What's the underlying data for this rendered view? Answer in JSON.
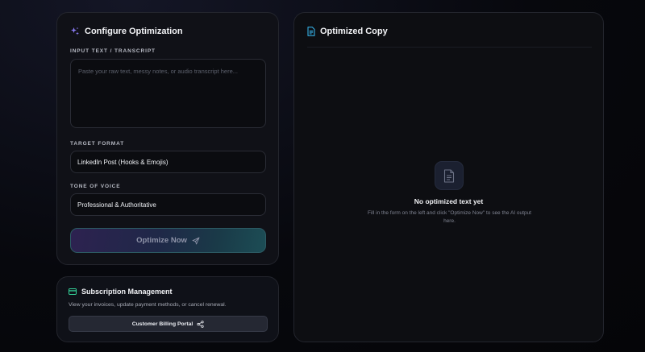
{
  "config": {
    "title": "Configure Optimization",
    "input_label": "INPUT TEXT / TRANSCRIPT",
    "input_placeholder": "Paste your raw text, messy notes, or audio transcript here...",
    "input_value": "",
    "format_label": "TARGET FORMAT",
    "format_value": "LinkedIn Post (Hooks & Emojis)",
    "tone_label": "TONE OF VOICE",
    "tone_value": "Professional & Authoritative",
    "optimize_label": "Optimize Now"
  },
  "billing": {
    "title": "Subscription Management",
    "description": "View your invoices, update payment methods, or cancel renewal.",
    "button_label": "Customer Billing Portal"
  },
  "output": {
    "title": "Optimized Copy",
    "empty_title": "No optimized text yet",
    "empty_description": "Fill in the form on the left and click \"Optimize Now\" to see the AI output here."
  },
  "icons": {
    "sparkles": "sparkles-icon",
    "card": "credit-card-icon",
    "document": "document-icon",
    "send": "send-icon",
    "share": "share-icon"
  },
  "colors": {
    "accent_purple": "#8b7cf6",
    "accent_cyan": "#38bdf8",
    "accent_green": "#34d399"
  }
}
